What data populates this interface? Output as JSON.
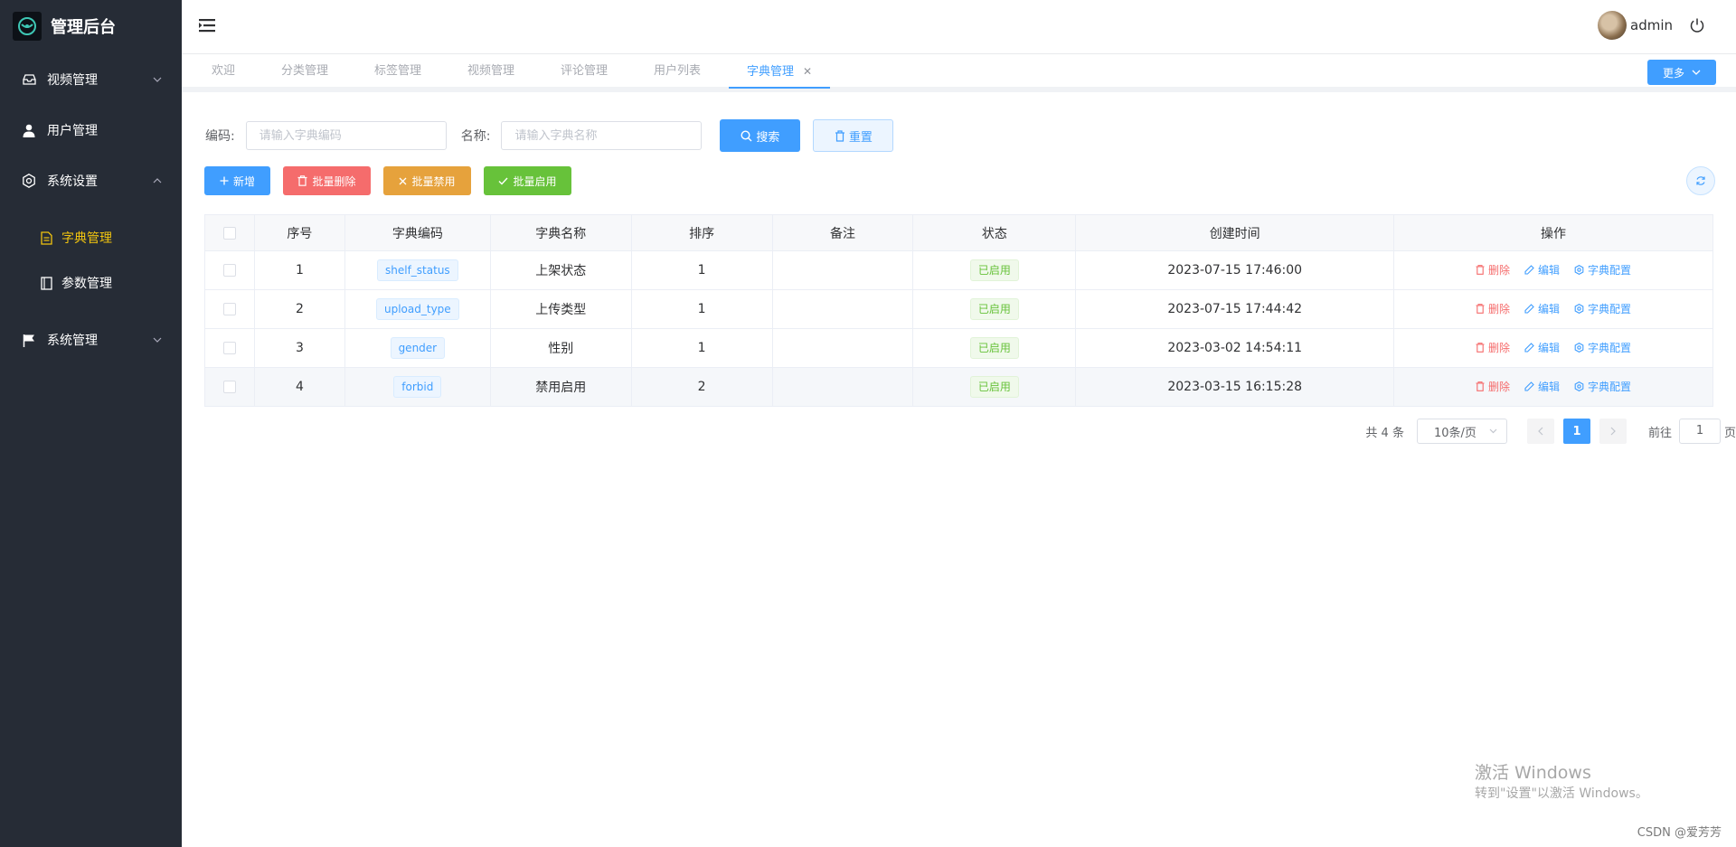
{
  "brand": {
    "title": "管理后台"
  },
  "sidebar": {
    "items": [
      {
        "label": "视频管理",
        "icon": "inbox-icon",
        "expanded": false
      },
      {
        "label": "用户管理",
        "icon": "user-icon"
      },
      {
        "label": "系统设置",
        "icon": "gear-icon",
        "expanded": true,
        "children": [
          {
            "label": "字典管理",
            "icon": "document-icon",
            "active": true
          },
          {
            "label": "参数管理",
            "icon": "notebook-icon",
            "active": false
          }
        ]
      },
      {
        "label": "系统管理",
        "icon": "flag-icon",
        "expanded": false
      }
    ]
  },
  "header": {
    "username": "admin"
  },
  "tabs": [
    {
      "label": "欢迎"
    },
    {
      "label": "分类管理"
    },
    {
      "label": "标签管理"
    },
    {
      "label": "视频管理"
    },
    {
      "label": "评论管理"
    },
    {
      "label": "用户列表"
    },
    {
      "label": "字典管理",
      "active": true
    }
  ],
  "more_label": "更多",
  "search": {
    "code_label": "编码:",
    "code_placeholder": "请输入字典编码",
    "name_label": "名称:",
    "name_placeholder": "请输入字典名称",
    "search_label": "搜索",
    "reset_label": "重置"
  },
  "actions": {
    "add": "新增",
    "batch_delete": "批量删除",
    "batch_disable": "批量禁用",
    "batch_enable": "批量启用"
  },
  "table": {
    "columns": [
      "序号",
      "字典编码",
      "字典名称",
      "排序",
      "备注",
      "状态",
      "创建时间",
      "操作"
    ],
    "rows": [
      {
        "index": "1",
        "code": "shelf_status",
        "name": "上架状态",
        "sort": "1",
        "remark": "",
        "status": "已启用",
        "created": "2023-07-15 17:46:00"
      },
      {
        "index": "2",
        "code": "upload_type",
        "name": "上传类型",
        "sort": "1",
        "remark": "",
        "status": "已启用",
        "created": "2023-07-15 17:44:42"
      },
      {
        "index": "3",
        "code": "gender",
        "name": "性别",
        "sort": "1",
        "remark": "",
        "status": "已启用",
        "created": "2023-03-02 14:54:11"
      },
      {
        "index": "4",
        "code": "forbid",
        "name": "禁用启用",
        "sort": "2",
        "remark": "",
        "status": "已启用",
        "created": "2023-03-15 16:15:28"
      }
    ],
    "ops": {
      "delete": "删除",
      "edit": "编辑",
      "config": "字典配置"
    }
  },
  "pagination": {
    "total": "共 4 条",
    "page_size": "10条/页",
    "current": "1",
    "goto_prefix": "前往",
    "goto_value": "1",
    "goto_suffix": "页"
  },
  "watermark": {
    "line1": "激活 Windows",
    "line2": "转到\"设置\"以激活 Windows。",
    "credit": "CSDN @爱芳芳"
  },
  "colors": {
    "primary": "#409eff",
    "danger": "#f56c6c",
    "warning": "#e6a23c",
    "success": "#67c23a",
    "sidebar_bg": "#262c36",
    "sidebar_active": "#f1c40f"
  }
}
